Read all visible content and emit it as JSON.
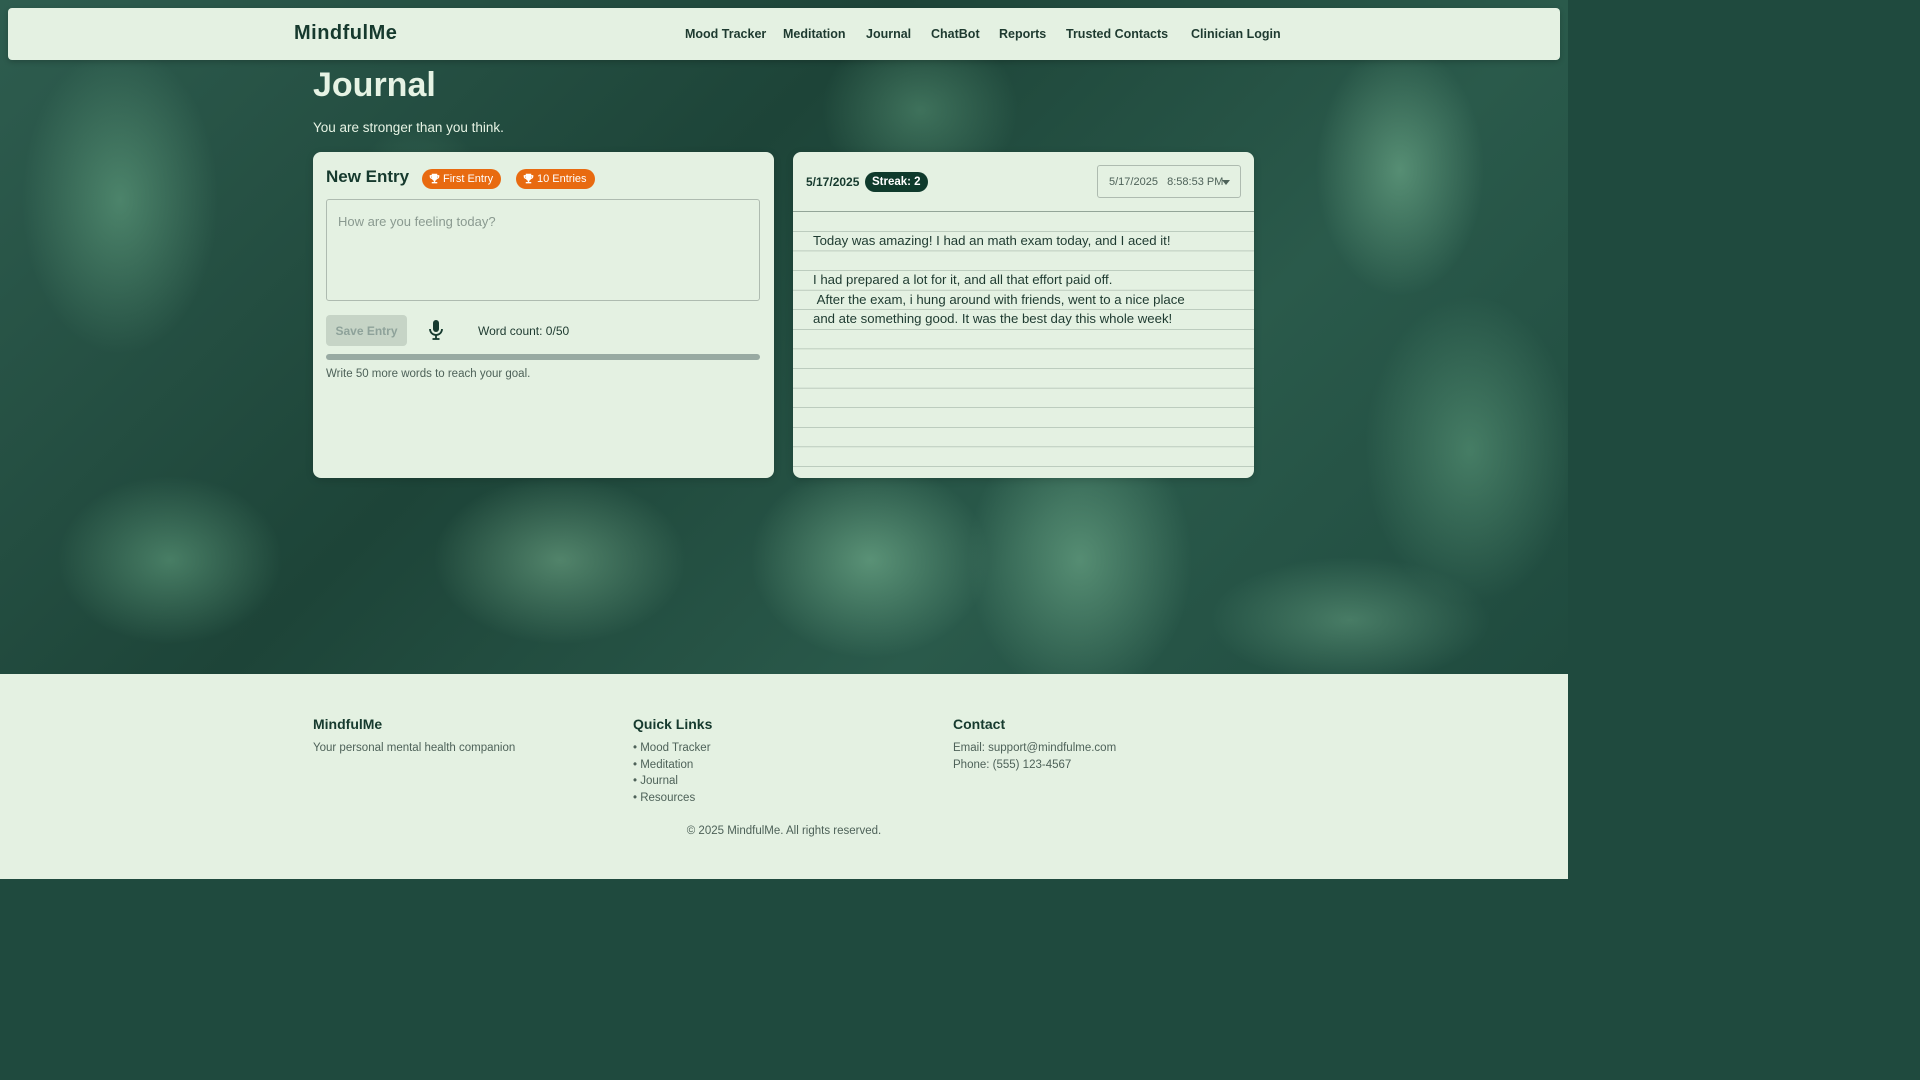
{
  "navbar": {
    "brand": "MindfulMe",
    "links": [
      "Mood Tracker",
      "Meditation",
      "Journal",
      "ChatBot",
      "Reports",
      "Trusted Contacts",
      "Clinician Login"
    ]
  },
  "page": {
    "title": "Journal",
    "subtitle": "You are stronger than you think."
  },
  "new_entry": {
    "heading": "New Entry",
    "badges": [
      "First Entry",
      "10 Entries"
    ],
    "placeholder": "How are you feeling today?",
    "save_label": "Save Entry",
    "word_count": "Word count: 0/50",
    "progress_fraction": 0,
    "goal_hint": "Write 50 more words to reach your goal."
  },
  "entry_view": {
    "date": "5/17/2025",
    "streak": "Streak: 2",
    "select_value": "5/17/2025   8:58:53 PM",
    "text": "Today was amazing! I had an math exam today, and I aced it!\n\nI had prepared a lot for it, and all that effort paid off.\n After the exam, i hung around with friends, went to a nice place\nand ate something good. It was the best day this whole week!"
  },
  "footer": {
    "brand_heading": "MindfulMe",
    "brand_text": "Your personal mental health companion",
    "links_heading": "Quick Links",
    "links": [
      "• Mood Tracker",
      "• Meditation",
      "• Journal",
      "• Resources"
    ],
    "contact_heading": "Contact",
    "email": "Email: support@mindfulme.com",
    "phone": "Phone: (555) 123-4567",
    "copyright": "© 2025 MindfulMe. All rights reserved."
  },
  "colors": {
    "accent_dark": "#163a2e",
    "badge_orange": "#e86a10",
    "panel_bg": "#e4f1e2"
  },
  "icons": [
    "trophy-icon",
    "microphone-icon",
    "chevron-down-icon"
  ]
}
